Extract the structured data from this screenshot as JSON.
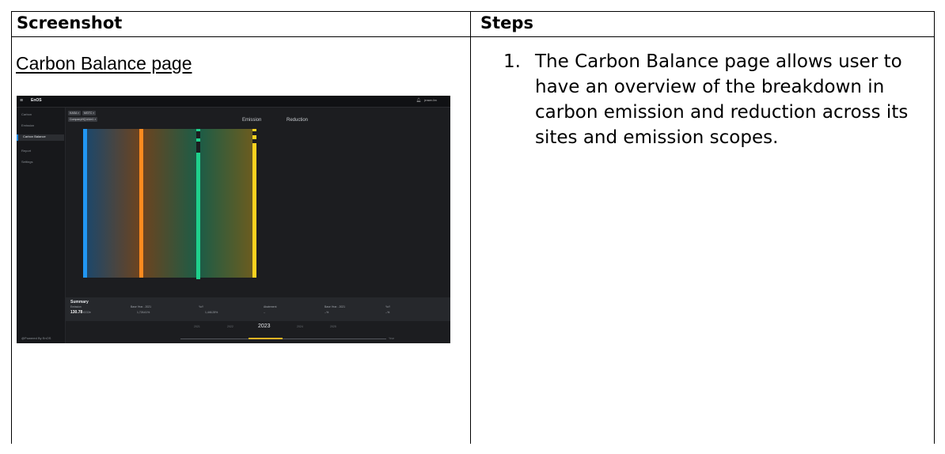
{
  "table": {
    "header_left": "Screenshot",
    "header_right": "Steps",
    "row_title": "Carbon Balance page",
    "step_number": "1.",
    "step_text": "The Carbon Balance page allows user to have an overview of the breakdown in carbon emission and reduction across its sites and emission scopes."
  },
  "screenshot": {
    "app_logo": "EnOS",
    "user_label": "jensen.lim",
    "sidebar": [
      {
        "label": "Carbon"
      },
      {
        "label": "Emission"
      },
      {
        "label": "Carbon Balance"
      },
      {
        "label": "Report"
      },
      {
        "label": "Settings"
      }
    ],
    "filter_chips": [
      "KASA ×",
      "MGTC ×",
      "CompanyHQ1A4e1 ×"
    ],
    "columns": {
      "emission": "Emission",
      "reduction": "Reduction"
    },
    "summary": {
      "title": "Summary",
      "emission_label": "Emission",
      "emission_value": "130.78",
      "emission_unit": "tCO2e",
      "base_year_label": "Base Year - 2021",
      "base_year_value": "1,726.61%",
      "yoy_label": "YoY",
      "yoy_value": "1,446.28%",
      "abatement_label": "Abatement",
      "abatement_value": "--",
      "base_year_label_2": "Base Year - 2021",
      "base_year_value_2": "--%",
      "yoy_label_2": "YoY",
      "yoy_value_2": "--%"
    },
    "years": [
      "2021",
      "2022",
      "2023",
      "2024",
      "2025"
    ],
    "selected_year": "2023",
    "year_unit": "Year",
    "powered_by": "@Powered By EnOS",
    "colors": {
      "blue": "#2196f3",
      "orange": "#ff8a1f",
      "green": "#1fd18c",
      "yellow": "#ffd21f",
      "accent": "#f5b524"
    }
  }
}
